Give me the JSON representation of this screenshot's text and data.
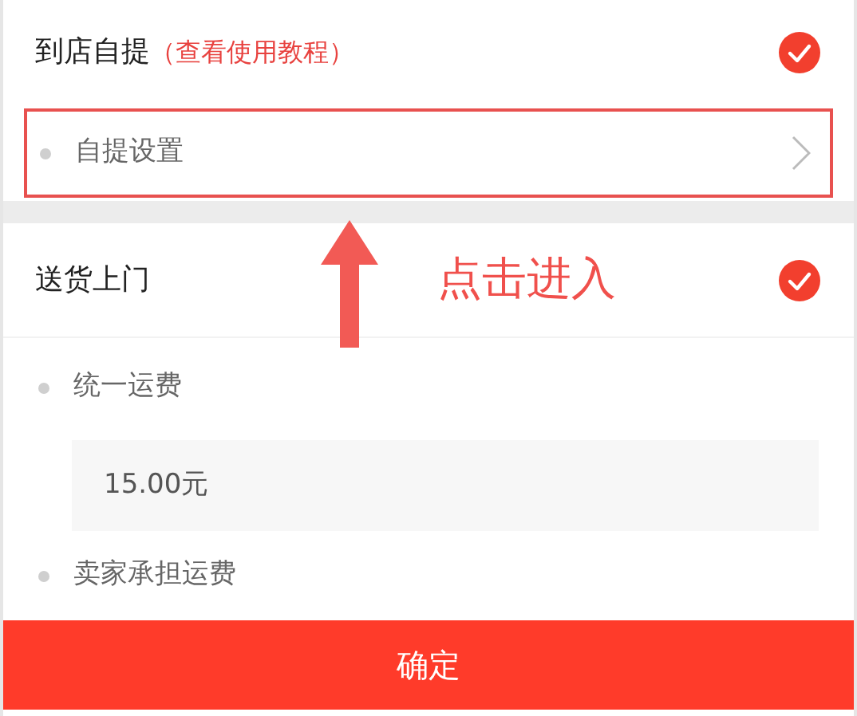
{
  "methods": [
    {
      "title": "到店自提",
      "link": "（查看使用教程）",
      "checked": true,
      "settings": [
        {
          "kind": "link",
          "label": "自提设置",
          "highlighted": true
        }
      ]
    },
    {
      "title": "送货上门",
      "checked": true,
      "settings": [
        {
          "kind": "label",
          "label": "统一运费"
        },
        {
          "kind": "value",
          "value": "15.00元"
        },
        {
          "kind": "label",
          "label": "卖家承担运费"
        }
      ]
    }
  ],
  "annotation": {
    "text": "点击进入"
  },
  "confirm_button": "确定"
}
